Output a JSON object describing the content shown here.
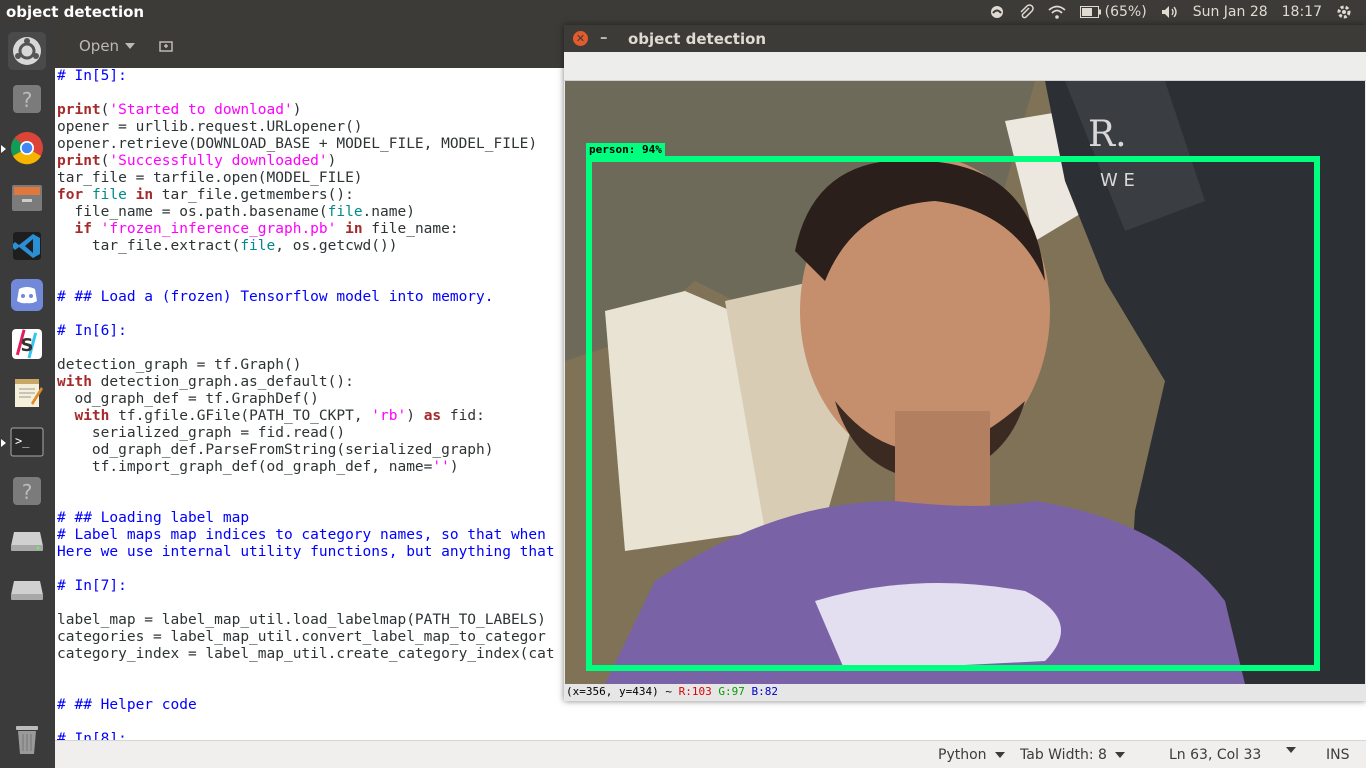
{
  "topbar": {
    "app_title": "object detection",
    "battery": "(65%)",
    "date": "Sun Jan 28",
    "time": "18:17"
  },
  "launcher": {
    "items": [
      {
        "name": "ubuntu-dash-icon"
      },
      {
        "name": "unknown-app-icon"
      },
      {
        "name": "chrome-icon"
      },
      {
        "name": "files-icon"
      },
      {
        "name": "vscode-icon"
      },
      {
        "name": "discord-icon"
      },
      {
        "name": "slack-icon"
      },
      {
        "name": "text-editor-icon"
      },
      {
        "name": "terminal-icon"
      },
      {
        "name": "unknown-app-icon"
      },
      {
        "name": "drive-icon"
      },
      {
        "name": "drive-icon"
      },
      {
        "name": "trash-icon"
      }
    ]
  },
  "gedit": {
    "open_label": "Open",
    "statusbar": {
      "language": "Python",
      "tab_width": "Tab Width: 8",
      "position": "Ln 63, Col 33",
      "mode": "INS"
    },
    "code_lines": [
      "# In[5]:",
      "",
      "print('Started to download')",
      "opener = urllib.request.URLopener()",
      "opener.retrieve(DOWNLOAD_BASE + MODEL_FILE, MODEL_FILE)",
      "print('Successfully downloaded')",
      "tar_file = tarfile.open(MODEL_FILE)",
      "for file in tar_file.getmembers():",
      "  file_name = os.path.basename(file.name)",
      "  if 'frozen_inference_graph.pb' in file_name:",
      "    tar_file.extract(file, os.getcwd())",
      "",
      "",
      "# ## Load a (frozen) Tensorflow model into memory.",
      "",
      "# In[6]:",
      "",
      "detection_graph = tf.Graph()",
      "with detection_graph.as_default():",
      "  od_graph_def = tf.GraphDef()",
      "  with tf.gfile.GFile(PATH_TO_CKPT, 'rb') as fid:",
      "    serialized_graph = fid.read()",
      "    od_graph_def.ParseFromString(serialized_graph)",
      "    tf.import_graph_def(od_graph_def, name='')",
      "",
      "",
      "# ## Loading label map",
      "# Label maps map indices to category names, so that when",
      "Here we use internal utility functions, but anything that",
      "",
      "# In[7]:",
      "",
      "label_map = label_map_util.load_labelmap(PATH_TO_LABELS)",
      "categories = label_map_util.convert_label_map_to_categor",
      "category_index = label_map_util.create_category_index(cat",
      "",
      "",
      "# ## Helper code",
      "",
      "# In[8]:"
    ]
  },
  "od_window": {
    "title": "object detection",
    "detection_label": "person: 94%",
    "status_coords": "(x=356, y=434) ~",
    "status_r": "R:103",
    "status_g": "G:97",
    "status_b": "B:82",
    "box_color": "#00ff7f"
  }
}
